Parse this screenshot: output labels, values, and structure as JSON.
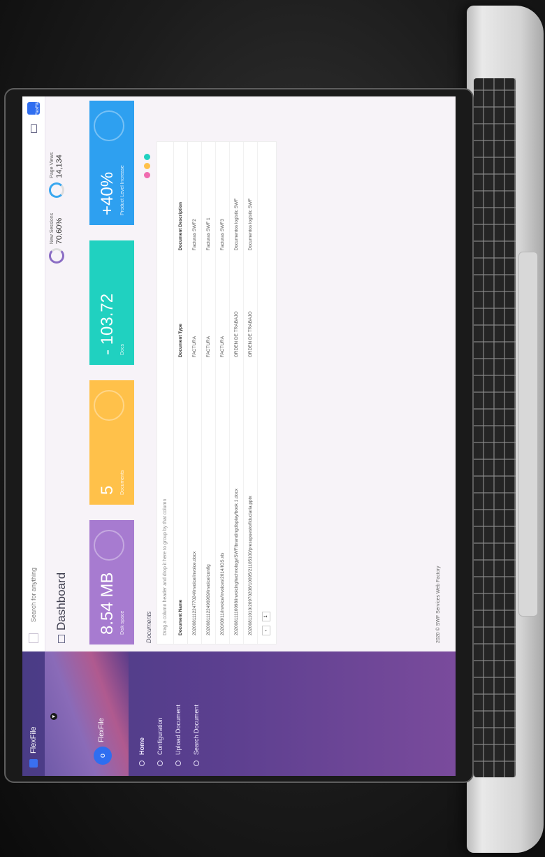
{
  "sidebar": {
    "app_name": "FlexFile",
    "user": "FlexFile",
    "avatar_letter": "o",
    "items": [
      {
        "label": "Home"
      },
      {
        "label": "Configuration"
      },
      {
        "label": "Upload Document"
      },
      {
        "label": "Search Document"
      }
    ]
  },
  "topbar": {
    "search_placeholder": "Search for anything",
    "avatar_label": "FlexFile"
  },
  "header": {
    "title": "Dashboard"
  },
  "stats": [
    {
      "label": "New Sessions",
      "value": "70.60%"
    },
    {
      "label": "Page Views",
      "value": "14,134"
    }
  ],
  "cards": [
    {
      "value": "8.54 MB",
      "label": "Disk space",
      "color": "#a77bd0"
    },
    {
      "value": "5",
      "label": "Documents",
      "color": "#ffc14a"
    },
    {
      "value": "- 103.72",
      "label": "Docs",
      "color": "#20d1c0"
    },
    {
      "value": "+40%",
      "label": "Product Level Increase",
      "color": "#2ea0f0"
    }
  ],
  "documents": {
    "label": "Documents",
    "drag_hint": "Drag a column header and drop it here to group by that column",
    "columns": [
      "Document Name",
      "Document Type",
      "Document Description"
    ],
    "rows": [
      [
        "20200811122477024/invoice/invoice.docx",
        "FACTURA",
        "Facturas SWF2"
      ],
      [
        "20200811122496969/invoice/config",
        "FACTURA",
        "Facturas SWF 1"
      ],
      [
        "2020/08/11/invoice/invoices/2014/IOS.xls",
        "FACTURA",
        "Facturas SWF3"
      ],
      [
        "20200811110098/invoicing/technology/SWF/brandingdisplay/book 1.docx",
        "ORDEN DE TRABAJO",
        "Documentos logistic SWF"
      ],
      [
        "20200811010/20970208/10095/21105100/presupuesto/fiduciaria.pptx",
        "ORDEN DE TRABAJO",
        "Documentos logistic SWF"
      ]
    ],
    "page": "1"
  },
  "footer": {
    "text": "2020 © SWF Services Web Factory"
  },
  "accent_colors": {
    "sidebar": "#5b3f8f",
    "dot_1": "#f06bb0",
    "dot_2": "#ffc14a",
    "dot_3": "#20d1c0"
  }
}
